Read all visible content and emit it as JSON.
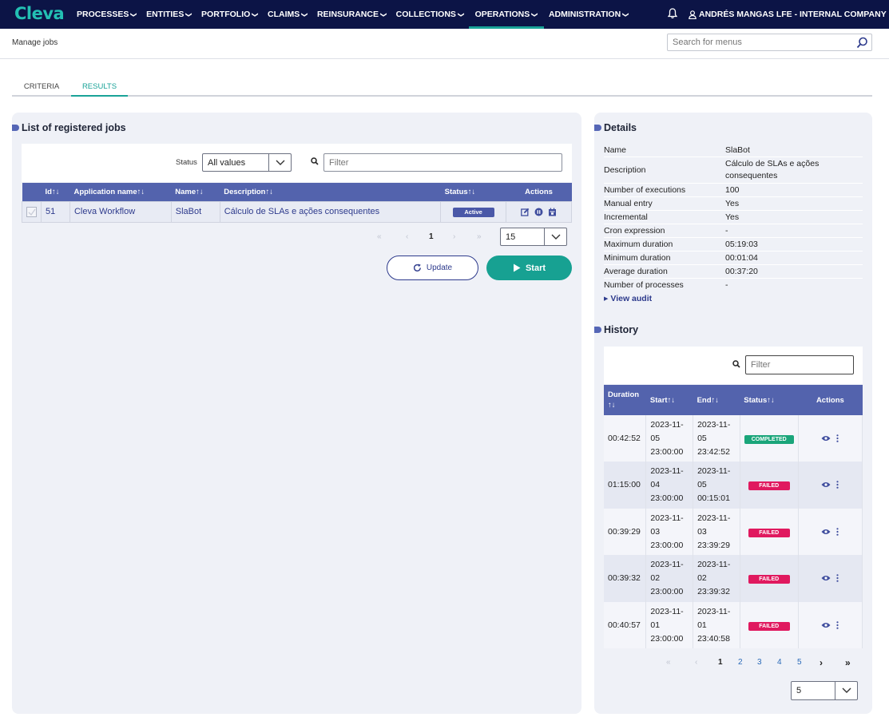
{
  "app": {
    "logo": "Cleva"
  },
  "nav": {
    "items": [
      {
        "label": "PROCESSES"
      },
      {
        "label": "ENTITIES"
      },
      {
        "label": "PORTFOLIO"
      },
      {
        "label": "CLAIMS"
      },
      {
        "label": "REINSURANCE"
      },
      {
        "label": "COLLECTIONS"
      },
      {
        "label": "OPERATIONS"
      },
      {
        "label": "ADMINISTRATION"
      }
    ],
    "user": "ANDRÉS MANGAS LFE - INTERNAL COMPANY"
  },
  "breadcrumb": "Manage jobs",
  "menu_search": {
    "placeholder": "Search for menus"
  },
  "tabs": [
    {
      "label": "CRITERIA"
    },
    {
      "label": "RESULTS"
    }
  ],
  "jobs_panel": {
    "title": "List of registered jobs",
    "status_label": "Status",
    "status_value": "All values",
    "filter_placeholder": "Filter",
    "columns": [
      "Id",
      "Application name",
      "Name",
      "Description",
      "Status",
      "Actions"
    ],
    "rows": [
      {
        "id": "51",
        "application": "Cleva Workflow",
        "name": "SlaBot",
        "description": "Cálculo de SLAs e ações consequentes",
        "status": "Active"
      }
    ],
    "pagination": {
      "current": "1",
      "page_size": "15"
    },
    "update_label": "Update",
    "start_label": "Start"
  },
  "details": {
    "title": "Details",
    "rows": [
      {
        "key": "Name",
        "value": "SlaBot"
      },
      {
        "key": "Description",
        "value": "Cálculo de SLAs e ações consequentes"
      },
      {
        "key": "Number of executions",
        "value": "100"
      },
      {
        "key": "Manual entry",
        "value": "Yes"
      },
      {
        "key": "Incremental",
        "value": "Yes"
      },
      {
        "key": "Cron expression",
        "value": "-"
      },
      {
        "key": "Maximum duration",
        "value": "05:19:03"
      },
      {
        "key": "Minimum duration",
        "value": "00:01:04"
      },
      {
        "key": "Average duration",
        "value": "00:37:20"
      },
      {
        "key": "Number of processes",
        "value": "-"
      }
    ],
    "view_audit": "View audit"
  },
  "history": {
    "title": "History",
    "filter_placeholder": "Filter",
    "columns": [
      "Duration",
      "Start",
      "End",
      "Status",
      "Actions"
    ],
    "rows": [
      {
        "duration": "00:42:52",
        "start": [
          "2023-11-",
          "05",
          "23:00:00"
        ],
        "end": [
          "2023-11-",
          "05",
          "23:42:52"
        ],
        "status": "COMPLETED"
      },
      {
        "duration": "01:15:00",
        "start": [
          "2023-11-",
          "04",
          "23:00:00"
        ],
        "end": [
          "2023-11-",
          "05",
          "00:15:01"
        ],
        "status": "FAILED"
      },
      {
        "duration": "00:39:29",
        "start": [
          "2023-11-",
          "03",
          "23:00:00"
        ],
        "end": [
          "2023-11-",
          "03",
          "23:39:29"
        ],
        "status": "FAILED"
      },
      {
        "duration": "00:39:32",
        "start": [
          "2023-11-",
          "02",
          "23:00:00"
        ],
        "end": [
          "2023-11-",
          "02",
          "23:39:32"
        ],
        "status": "FAILED"
      },
      {
        "duration": "00:40:57",
        "start": [
          "2023-11-",
          "01",
          "23:00:00"
        ],
        "end": [
          "2023-11-",
          "01",
          "23:40:58"
        ],
        "status": "FAILED"
      }
    ],
    "pages": [
      "1",
      "2",
      "3",
      "4",
      "5"
    ],
    "page_size": "5"
  },
  "colors": {
    "nav_bg": "#0c1446",
    "accent": "#1aa398",
    "table_header": "#5363ad",
    "completed": "#1aa57a",
    "failed": "#e0195f",
    "active": "#4a58a8"
  }
}
